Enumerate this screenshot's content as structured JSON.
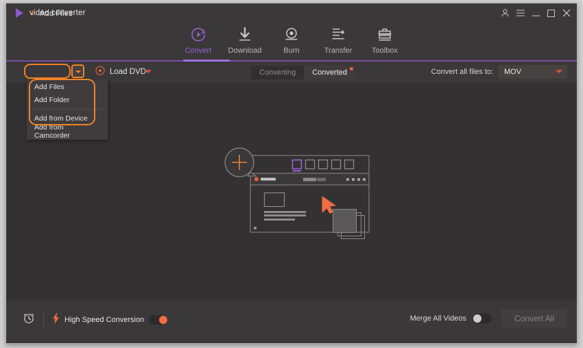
{
  "window": {
    "title": "video converter",
    "brand_icon": "play-triangle-icon",
    "brand_color": "#8e57c9",
    "controls": [
      {
        "name": "account-icon",
        "glyph": "person"
      },
      {
        "name": "menu-icon",
        "glyph": "hamburger"
      },
      {
        "name": "minimize-icon",
        "glyph": "minimize"
      },
      {
        "name": "maximize-icon",
        "glyph": "maximize"
      },
      {
        "name": "close-icon",
        "glyph": "close"
      }
    ]
  },
  "nav": {
    "active": "Convert",
    "accent": "#9a63d6",
    "items": [
      {
        "label": "Convert",
        "icon": "convert-circular-arrow-icon"
      },
      {
        "label": "Download",
        "icon": "download-arrow-icon"
      },
      {
        "label": "Burn",
        "icon": "burn-disc-icon"
      },
      {
        "label": "Transfer",
        "icon": "transfer-icon"
      },
      {
        "label": "Toolbox",
        "icon": "toolbox-icon"
      }
    ]
  },
  "toolbar": {
    "add_files_label": "Add Files",
    "add_files_icon": "plus-icon",
    "add_files_caret_icon": "chevron-down-icon",
    "load_dvd_label": "Load DVD",
    "load_dvd_icon": "disc-icon",
    "load_dvd_caret_icon": "chevron-down-icon",
    "segments": [
      {
        "label": "Converting",
        "state": "pressed",
        "badge": false
      },
      {
        "label": "Converted",
        "state": "normal",
        "badge": true
      }
    ],
    "convert_to_label": "Convert all files to:",
    "format_value": "MOV",
    "format_caret_icon": "chevron-down-icon",
    "accent_orange": "#e8833a",
    "accent_red": "#e8613a"
  },
  "dropdown_menu": {
    "groups": [
      {
        "items": [
          "Add Files",
          "Add Folder"
        ]
      },
      {
        "items": [
          "Add from Device",
          "Add from Camcorder"
        ]
      }
    ]
  },
  "annotations": {
    "color": "#ef8326",
    "targets": [
      "add-files-button",
      "add-files-caret-button",
      "dropdown-menu-items"
    ]
  },
  "main": {
    "illustration": "drag-and-drop-window-illustration",
    "plus_badge_icon": "plus-icon",
    "cursor_icon": "arrow-cursor-icon"
  },
  "bottom_bar": {
    "timer_icon": "alarm-clock-icon",
    "bolt_icon": "lightning-bolt-icon",
    "high_speed_label": "High Speed Conversion",
    "high_speed_state": "on",
    "merge_label": "Merge All Videos",
    "merge_state": "off",
    "convert_all_label": "Convert All",
    "convert_all_enabled": false
  }
}
